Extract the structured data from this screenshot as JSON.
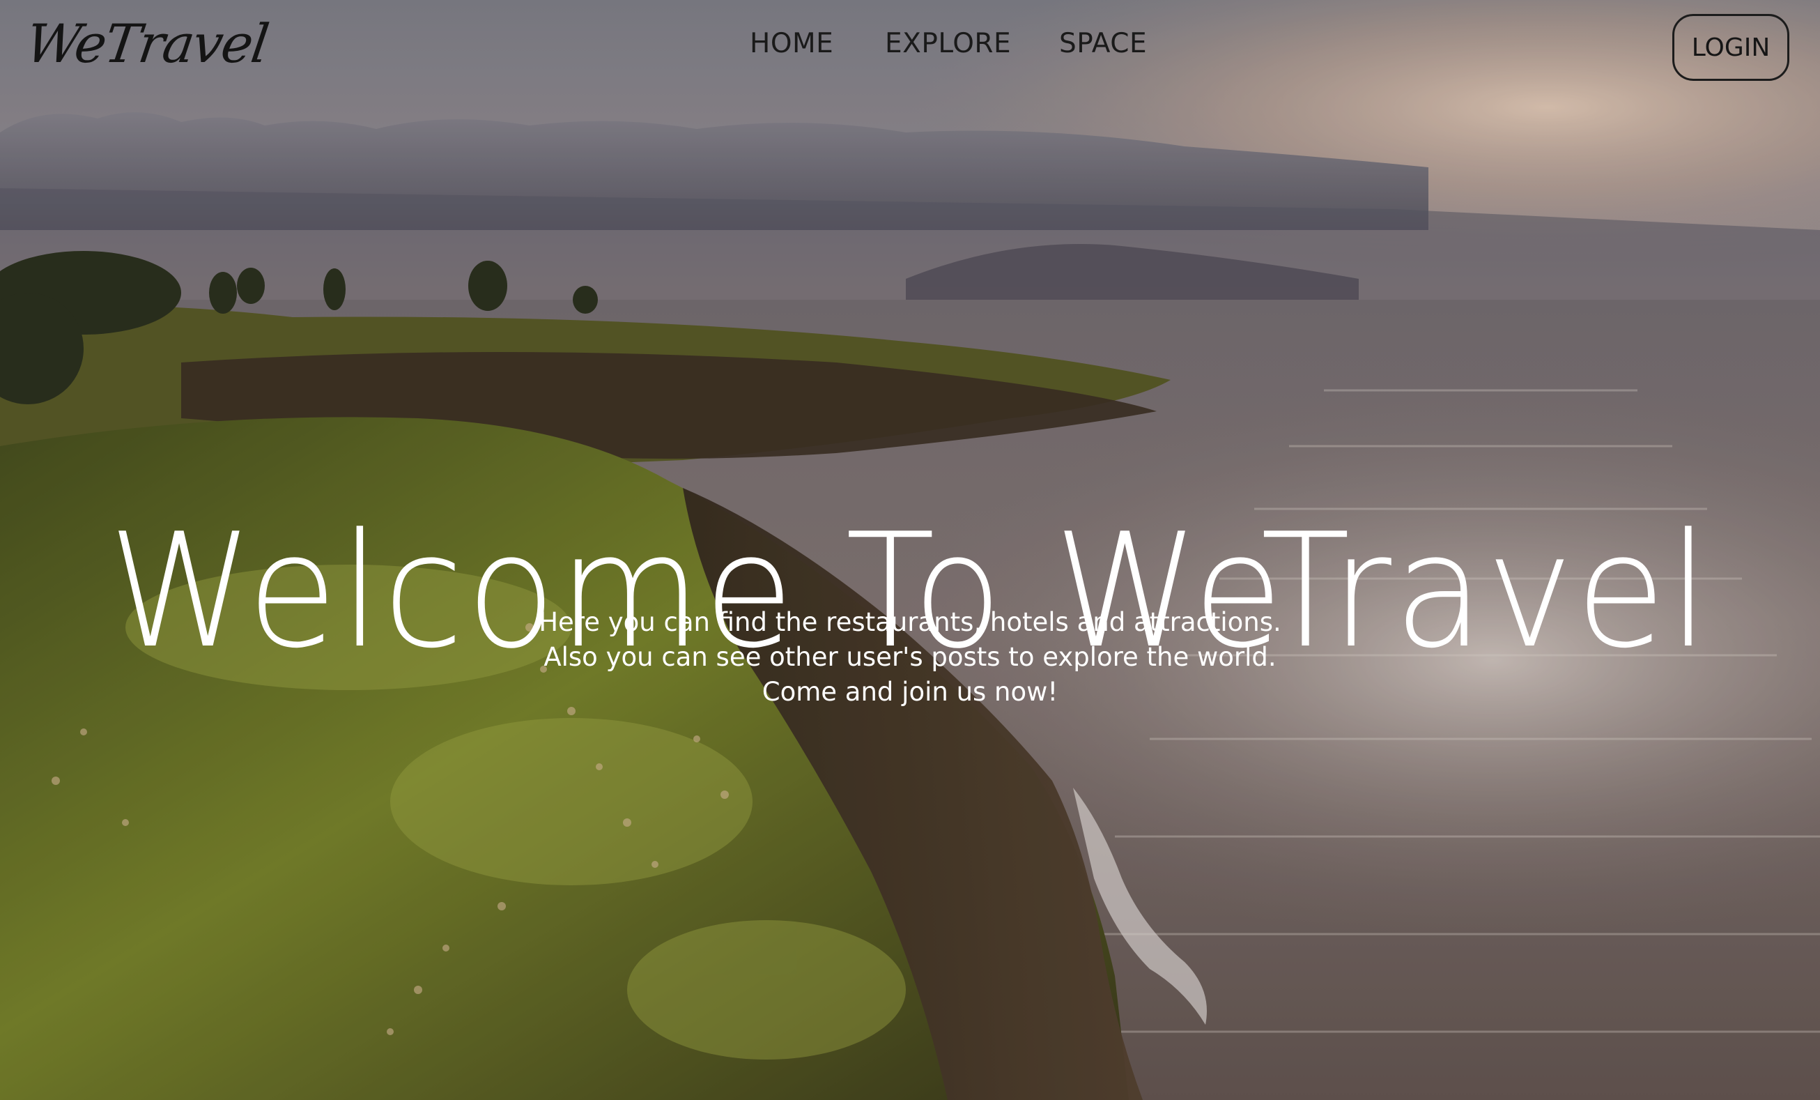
{
  "brand": {
    "logo_text": "WeTravel"
  },
  "nav": {
    "items": [
      {
        "label": "HOME"
      },
      {
        "label": "EXPLORE"
      },
      {
        "label": "SPACE"
      }
    ],
    "login_label": "LOGIN"
  },
  "hero": {
    "title": "Welcome To WeTravel",
    "subtitle_lines": [
      "Here you can find the restaurants, hotels and attractions.",
      "Also you can see other user's posts to explore the world.",
      "Come and join us now!"
    ],
    "background": {
      "subject": "coastal cliff at sunset with ocean and clouds",
      "colors": {
        "sky": "#8e8c94",
        "sunglow": "#d9b9a2",
        "ocean": "#776d6e",
        "grass": "#6f7a2a",
        "cliff": "#4a3a2c"
      }
    }
  },
  "colors": {
    "nav_text": "#1a1a1a",
    "hero_text": "#ffffff",
    "button_border": "#1c1c1c"
  }
}
